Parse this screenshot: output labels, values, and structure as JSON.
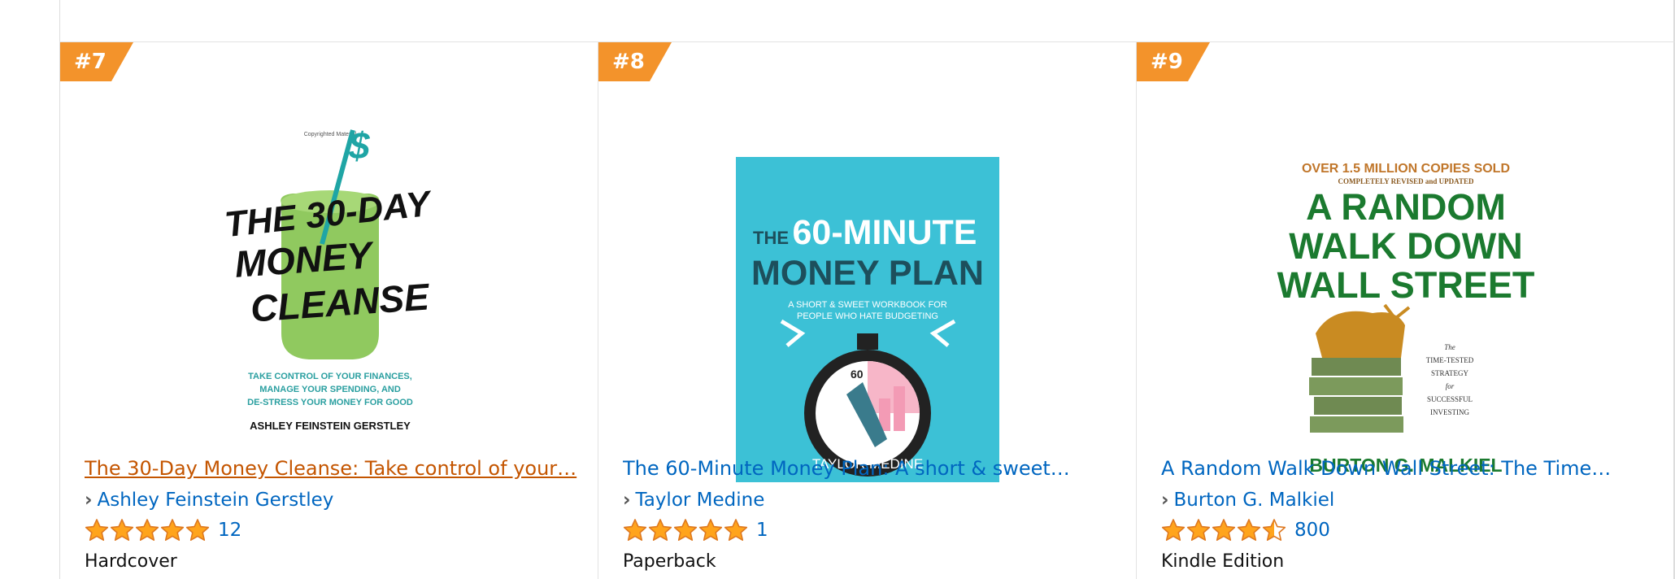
{
  "colors": {
    "link": "#0066c0",
    "link_active": "#c45500",
    "rank_badge": "#f3932b",
    "star": "#ffa41c"
  },
  "products": [
    {
      "rank": "#7",
      "title": "The 30-Day Money Cleanse: Take control of your…",
      "author": "Ashley Feinstein Gerstley",
      "rating": 5,
      "review_count": "12",
      "format": "Hardcover",
      "cover": {
        "caption": "Copyrighted Material",
        "title_lines": [
          "THE 30-DAY",
          "MONEY",
          "CLEANSE"
        ],
        "tagline_lines": [
          "TAKE CONTROL OF YOUR FINANCES,",
          "MANAGE YOUR SPENDING, AND",
          "DE-STRESS YOUR MONEY FOR GOOD"
        ],
        "author": "ASHLEY FEINSTEIN GERSTLEY"
      }
    },
    {
      "rank": "#8",
      "title": "The 60-Minute Money Plan: A short & sweet…",
      "author": "Taylor Medine",
      "rating": 5,
      "review_count": "1",
      "format": "Paperback",
      "cover": {
        "title_small": "THE",
        "title_lines": [
          "60-MINUTE",
          "MONEY PLAN"
        ],
        "tagline_lines": [
          "A SHORT & SWEET WORKBOOK FOR",
          "PEOPLE WHO HATE BUDGETING"
        ],
        "clock_label": "60",
        "author": "TAYLOR MEDINE"
      }
    },
    {
      "rank": "#9",
      "title": "A Random Walk Down Wall Street: The Time…",
      "author": "Burton G. Malkiel",
      "rating": 4.5,
      "review_count": "800",
      "format": "Kindle Edition",
      "cover": {
        "banner": "OVER 1.5 MILLION COPIES SOLD",
        "subbanner": "COMPLETELY REVISED and UPDATED",
        "title_lines": [
          "A RANDOM",
          "WALK DOWN",
          "WALL STREET"
        ],
        "tagline_lines": [
          "The",
          "TIME-TESTED",
          "STRATEGY",
          "for",
          "SUCCESSFUL",
          "INVESTING"
        ],
        "author": "BURTON G. MALKIEL"
      }
    }
  ]
}
